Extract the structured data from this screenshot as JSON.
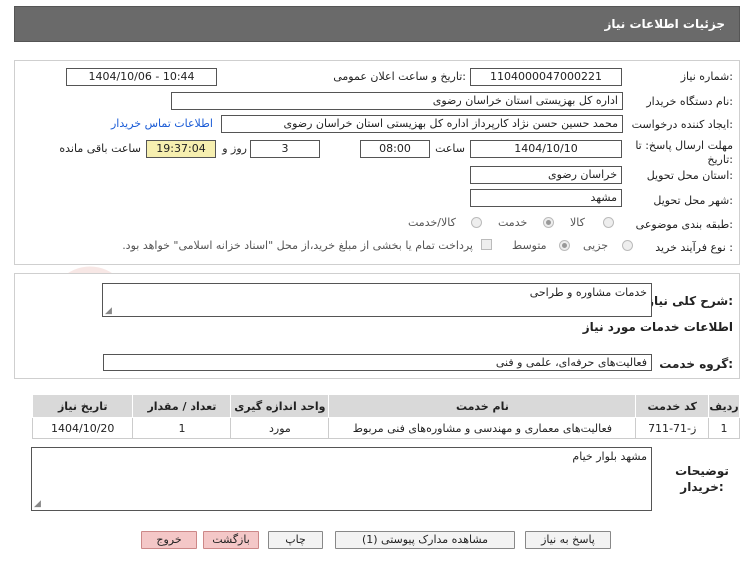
{
  "header": {
    "title": "جزئیات اطلاعات نیاز"
  },
  "form": {
    "need_number_label": "شماره نیاز:",
    "need_number": "1104000047000221",
    "announce_label": "تاریخ و ساعت اعلان عمومی:",
    "announce_value": "1404/10/06 - 10:44",
    "buyer_org_label": "نام دستگاه خریدار:",
    "buyer_org": "اداره کل بهزیستی استان خراسان رضوی",
    "creator_label": "ایجاد کننده درخواست:",
    "creator": "محمد حسین حسن نژاد کارپرداز اداره کل بهزیستی استان خراسان رضوی",
    "contact_link": "اطلاعات تماس خریدار",
    "deadline_label": "مهلت ارسال پاسخ: تا تاریخ:",
    "deadline_date": "1404/10/10",
    "time_label": "ساعت",
    "deadline_time": "08:00",
    "days": "3",
    "days_label": "روز و",
    "remaining_time": "19:37:04",
    "remaining_label": "ساعت باقی مانده",
    "province_label": "استان محل تحویل:",
    "province": "خراسان رضوی",
    "city_label": "شهر محل تحویل:",
    "city": "مشهد",
    "category_label": "طبقه بندی موضوعی:",
    "category_options": [
      "کالا",
      "خدمت",
      "کالا/خدمت"
    ],
    "purchase_type_label": "نوع فرآیند خرید :",
    "purchase_options": [
      "جزیی",
      "متوسط"
    ],
    "payment_note": "پرداخت تمام یا بخشی از مبلغ خرید،از محل \"اسناد خزانه اسلامی\" خواهد بود."
  },
  "summary": {
    "label": "شرح کلی نیاز:",
    "value": "خدمات مشاوره و طراحی",
    "services_heading": "اطلاعات خدمات مورد نیاز",
    "group_label": "گروه خدمت:",
    "group_value": "فعالیت‌های حرفه‌ای، علمی و فنی"
  },
  "table": {
    "headers": [
      "ردیف",
      "کد خدمت",
      "نام خدمت",
      "واحد اندازه گیری",
      "تعداد / مقدار",
      "تاریخ نیاز"
    ],
    "rows": [
      {
        "row": "1",
        "code": "ز-71-711",
        "name": "فعالیت‌های معماری و مهندسی و مشاوره‌های فنی مربوط",
        "unit": "مورد",
        "qty": "1",
        "date": "1404/10/20"
      }
    ]
  },
  "buyer_notes": {
    "label": "توضیحات خریدار:",
    "value": "مشهد بلوار خیام"
  },
  "buttons": {
    "reply": "پاسخ به نیاز",
    "attachments": "مشاهده مدارک پیوستی (1)",
    "print": "چاپ",
    "back": "بازگشت",
    "exit": "خروج"
  },
  "watermark": {
    "text": "AriaTender.net"
  },
  "colors": {
    "titlebar": "#6a6a6a",
    "link": "#1a5bd6",
    "highlight": "#f6efb0",
    "exit_button": "#f4c7c7"
  }
}
